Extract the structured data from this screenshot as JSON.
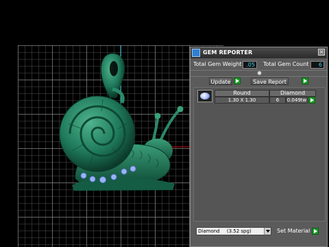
{
  "panel": {
    "title": "GEM REPORTER",
    "close_glyph": "×",
    "total_gem_weight_label": "Total Gem Weight",
    "total_gem_weight_value": ".05",
    "total_gem_count_label": "Total Gem Count",
    "total_gem_count_value": "6",
    "update_label": "Update",
    "save_report_label": "Save Report",
    "table": {
      "headers": [
        "Round",
        "Diamond"
      ],
      "row": {
        "size": "1.30 X 1.30",
        "count": "6",
        "weight": "0.049tw"
      }
    },
    "material_select": {
      "name": "Diamond",
      "detail": "(3.52 spg)"
    },
    "set_material_label": "Set Material"
  },
  "colors": {
    "model_green": "#1f7a5c",
    "gem_blue": "#9bb2f5",
    "value_text": "#3fd0ff",
    "go_button": "#1e9b2a",
    "axis_red": "#d01010",
    "axis_cyan": "#1fb8c8"
  },
  "icons": [
    "gem-reporter-app-icon",
    "close-icon",
    "go-arrow-icon",
    "gem-thumbnail-icon",
    "dropdown-arrow-icon",
    "slider-knob-icon"
  ]
}
